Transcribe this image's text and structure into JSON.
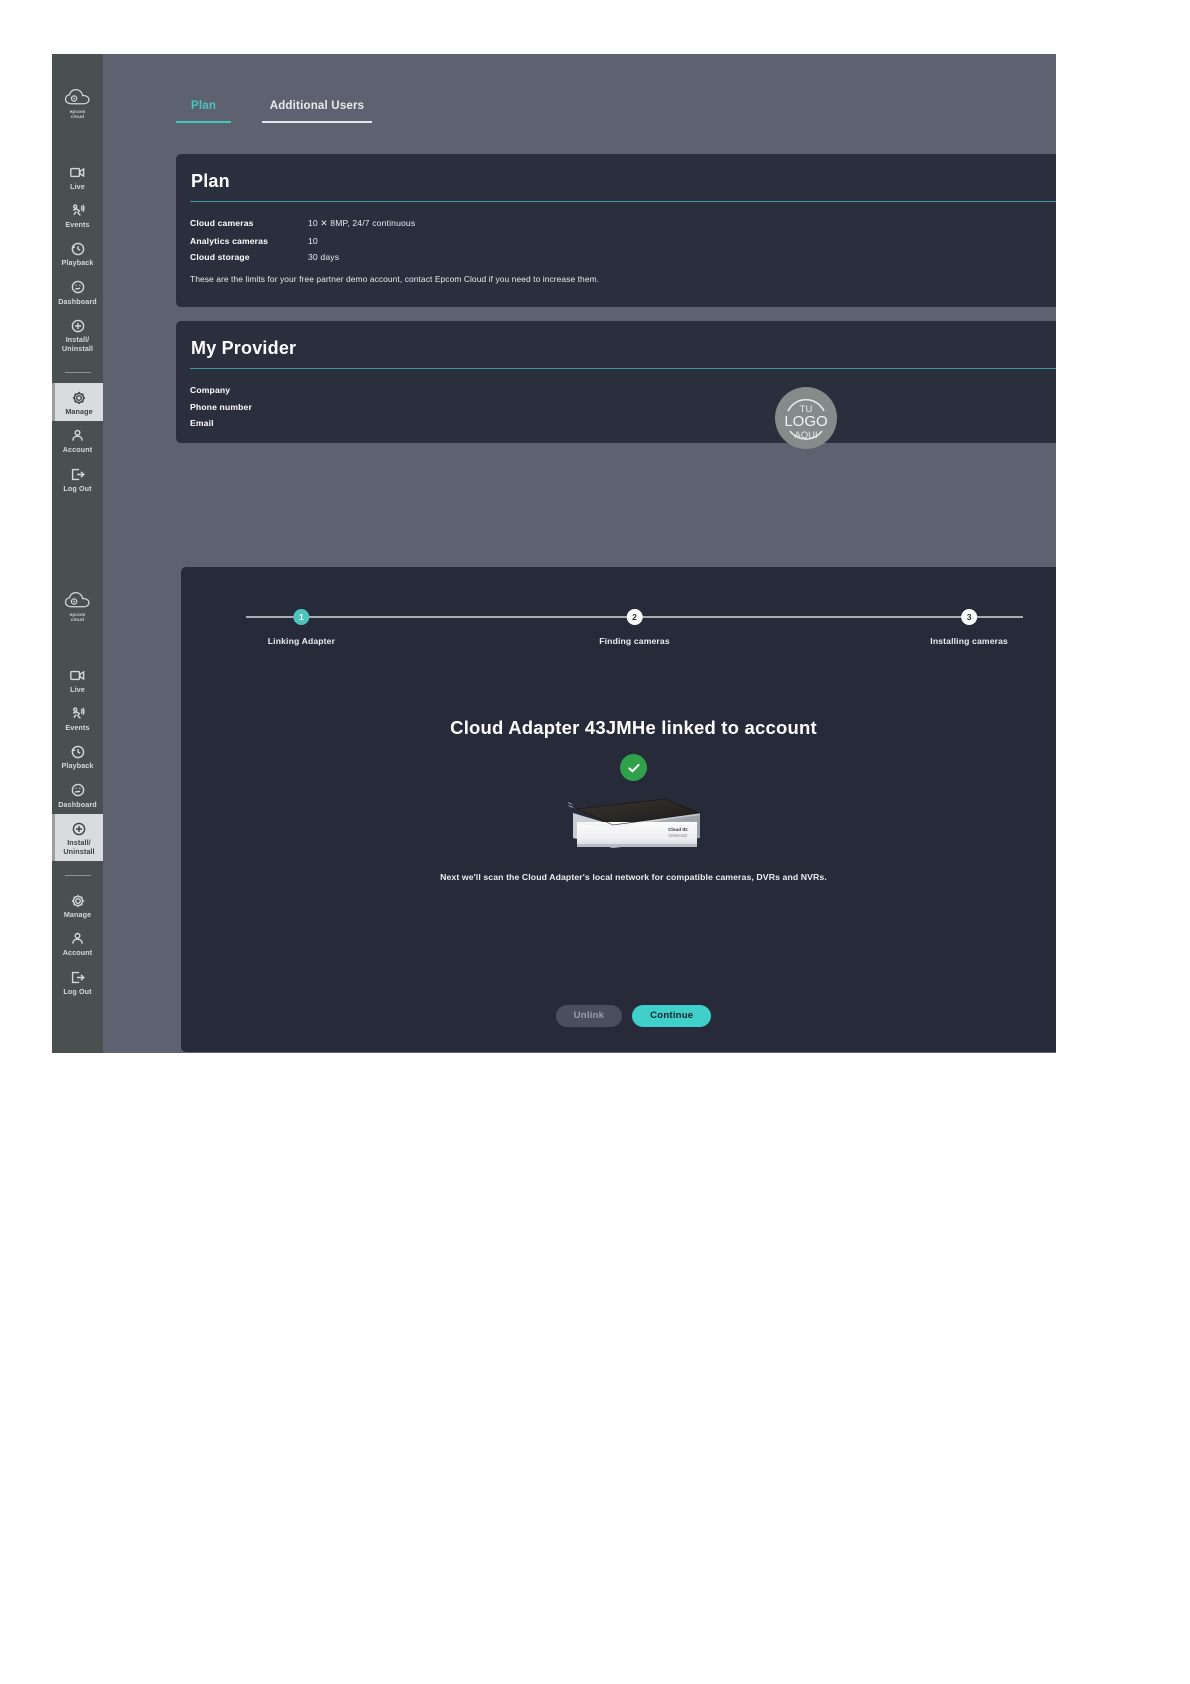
{
  "brand": {
    "logo_line1": "epcom",
    "logo_line2": "cloud",
    "accent": "#46c5c0",
    "panel_bg": "#2b2e3d",
    "app_bg": "#5e6170",
    "sidebar_bg": "#4a4f50",
    "success_green": "#2fa14a",
    "continue_button_color": "#3fd0c9"
  },
  "sidebar": {
    "primary_items": [
      {
        "label": "Live",
        "icon": "camera-icon",
        "active": false
      },
      {
        "label": "Events",
        "icon": "motion-alert-icon",
        "active": false
      },
      {
        "label": "Playback",
        "icon": "clock-rewind-icon",
        "active": false
      },
      {
        "label": "Dashboard",
        "icon": "gauge-icon",
        "active": false
      },
      {
        "label": "Install/\nUninstall",
        "icon": "plus-circle-icon",
        "active": false
      }
    ],
    "secondary_items": [
      {
        "label": "Manage",
        "icon": "gear-icon",
        "active": true
      },
      {
        "label": "Account",
        "icon": "user-icon",
        "active": false
      },
      {
        "label": "Log Out",
        "icon": "logout-icon",
        "active": false
      }
    ],
    "primary_items_bottom": [
      {
        "label": "Live",
        "icon": "camera-icon",
        "active": false
      },
      {
        "label": "Events",
        "icon": "motion-alert-icon",
        "active": false
      },
      {
        "label": "Playback",
        "icon": "clock-rewind-icon",
        "active": false
      },
      {
        "label": "Dashboard",
        "icon": "gauge-icon",
        "active": false
      },
      {
        "label": "Install/\nUninstall",
        "icon": "plus-circle-icon",
        "active": true
      }
    ],
    "secondary_items_bottom": [
      {
        "label": "Manage",
        "icon": "gear-icon",
        "active": false
      },
      {
        "label": "Account",
        "icon": "user-icon",
        "active": false
      },
      {
        "label": "Log Out",
        "icon": "logout-icon",
        "active": false
      }
    ]
  },
  "tabs": [
    {
      "label": "Plan",
      "active": true
    },
    {
      "label": "Additional Users",
      "active": false
    }
  ],
  "plan_card": {
    "title": "Plan",
    "rows": [
      {
        "key": "Cloud cameras",
        "value": "10 ✕ 8MP, 24/7 continuous"
      },
      {
        "key": "Analytics cameras",
        "value": "10"
      },
      {
        "key": "Cloud storage",
        "value": "30 days"
      }
    ],
    "note": "These are the limits for your free partner demo account, contact Epcom Cloud if you need to increase them."
  },
  "provider_card": {
    "title": "My Provider",
    "rows": [
      {
        "key": "Company",
        "value": ""
      },
      {
        "key": "Phone number",
        "value": ""
      },
      {
        "key": "Email",
        "value": ""
      }
    ],
    "logo_placeholder": {
      "line1": "TU",
      "line2": "LOGO",
      "line3": "AQUI"
    }
  },
  "wizard": {
    "steps": [
      {
        "number": "1",
        "label": "Linking Adapter",
        "state": "current"
      },
      {
        "number": "2",
        "label": "Finding cameras",
        "state": "pending"
      },
      {
        "number": "3",
        "label": "Installing cameras",
        "state": "pending"
      }
    ],
    "title": "Cloud Adapter 43JMHe linked to account",
    "status_icon": "check-circle-icon",
    "device": {
      "caption_key": "Cloud ID:",
      "caption_value": "CMNmxO"
    },
    "subtitle": "Next we'll scan the Cloud Adapter's local network for compatible cameras, DVRs and NVRs.",
    "buttons": {
      "unlink": "Unlink",
      "continue": "Continue"
    }
  }
}
